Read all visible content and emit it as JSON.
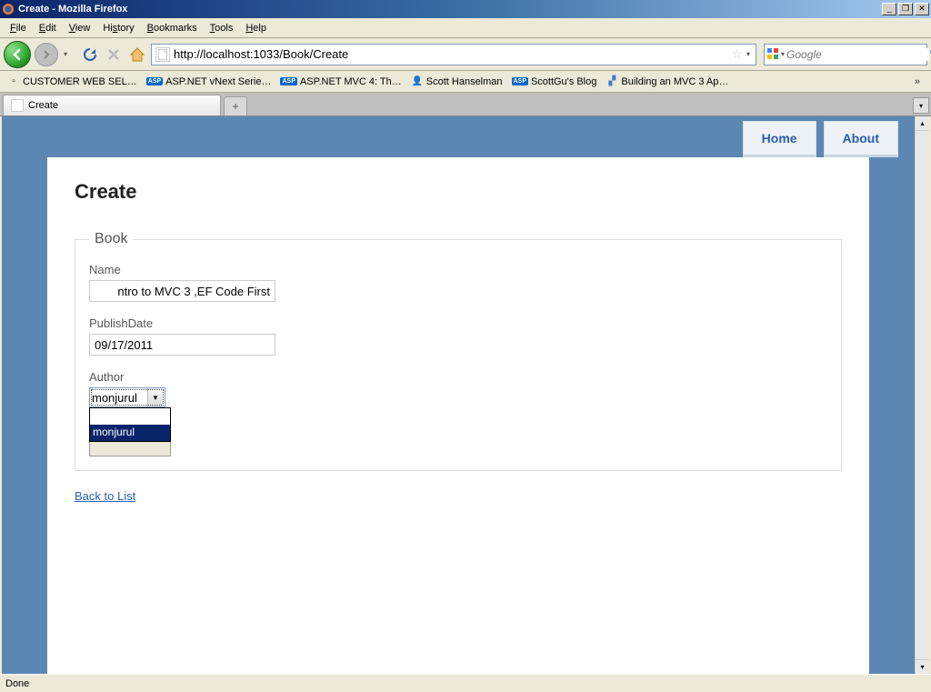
{
  "window": {
    "title": "Create - Mozilla Firefox"
  },
  "menu": {
    "file": "File",
    "edit": "Edit",
    "view": "View",
    "history": "History",
    "bookmarks": "Bookmarks",
    "tools": "Tools",
    "help": "Help"
  },
  "nav": {
    "url": "http://localhost:1033/Book/Create",
    "search_placeholder": "Google"
  },
  "bookmarks": [
    "CUSTOMER WEB SEL…",
    "ASP.NET vNext Serie…",
    "ASP.NET MVC 4: Th…",
    "Scott Hanselman",
    "ScottGu's Blog",
    "Building an MVC 3 Ap…"
  ],
  "tab": {
    "title": "Create"
  },
  "page": {
    "heading": "Create",
    "legend": "Book",
    "labels": {
      "name": "Name",
      "publishdate": "PublishDate",
      "author": "Author"
    },
    "values": {
      "name": "ntro to MVC 3 ,EF Code First",
      "publishdate": "09/17/2011",
      "author_selected": "monjurul"
    },
    "author_options": {
      "blank": "",
      "monjurul": "monjurul"
    },
    "back_link": "Back to List",
    "nav_home": "Home",
    "nav_about": "About"
  },
  "status": {
    "text": "Done"
  }
}
